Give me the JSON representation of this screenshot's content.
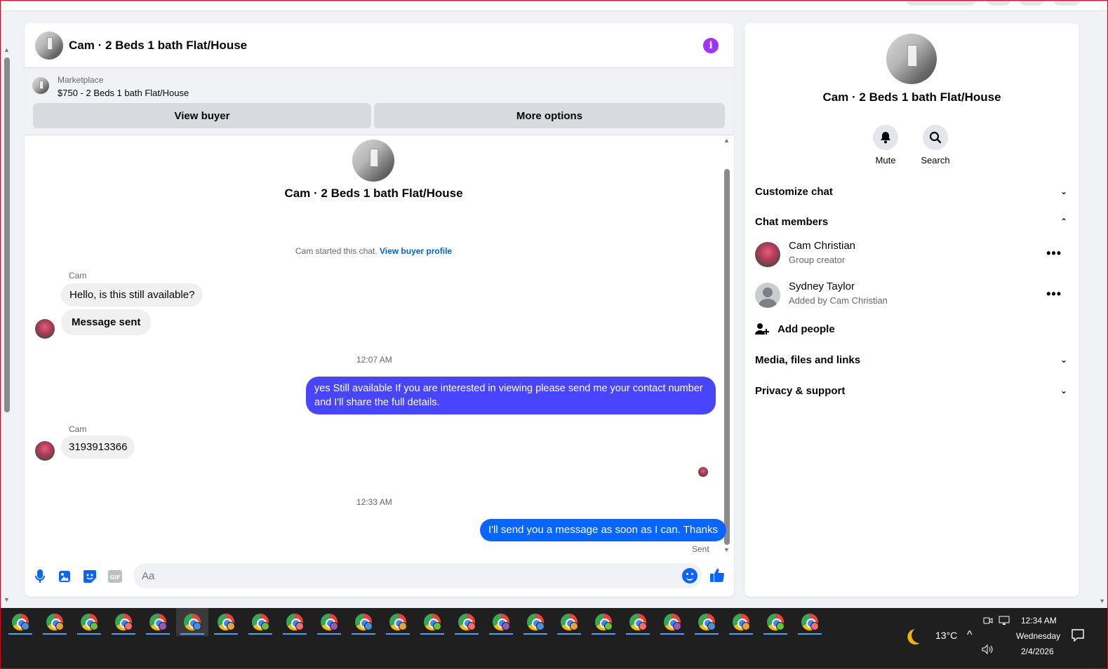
{
  "header": {
    "title": "Cam · 2 Beds 1 bath Flat/House",
    "info_icon": "info-icon"
  },
  "marketplace": {
    "label": "Marketplace",
    "listing": "$750 - 2 Beds 1 bath Flat/House",
    "view_buyer": "View buyer",
    "more_options": "More options"
  },
  "conversation": {
    "title": "Cam · 2 Beds 1 bath Flat/House",
    "started_text": "Cam started this chat.",
    "view_profile_link": "View buyer profile",
    "messages": [
      {
        "sender": "Cam",
        "text": "Hello, is this still available?"
      },
      {
        "text": "Message sent"
      },
      {
        "time": "12:07 AM"
      },
      {
        "text": "yes Still available If you are interested in viewing please send me your contact number and I'll share the full details."
      },
      {
        "sender": "Cam",
        "text": "3193913366"
      },
      {
        "time": "12:33 AM"
      },
      {
        "text": "I'll send you a message as soon as I can. Thanks",
        "status": "Sent"
      }
    ]
  },
  "composer": {
    "placeholder": "Aa",
    "icons": [
      "microphone-icon",
      "image-icon",
      "sticker-icon",
      "gif-icon",
      "emoji-icon",
      "thumbs-up-icon"
    ]
  },
  "details": {
    "title": "Cam · 2 Beds 1 bath Flat/House",
    "mute": "Mute",
    "search": "Search",
    "sections": {
      "customize": "Customize chat",
      "members": "Chat members",
      "media": "Media, files and links",
      "privacy": "Privacy & support"
    },
    "members": [
      {
        "name": "Cam Christian",
        "role": "Group creator"
      },
      {
        "name": "Sydney Taylor",
        "role": "Added by Cam Christian"
      }
    ],
    "add_people": "Add people"
  },
  "taskbar": {
    "app_count": 24,
    "app_icon": "chrome-icon",
    "temperature": "13°C",
    "time": "12:34 AM",
    "day": "Wednesday",
    "date": "2/4/2026"
  },
  "colors": {
    "outgoing": "#4745ff",
    "outgoing_last": "#0866ff",
    "accent": "#0866ff",
    "info": "#a033ff"
  }
}
